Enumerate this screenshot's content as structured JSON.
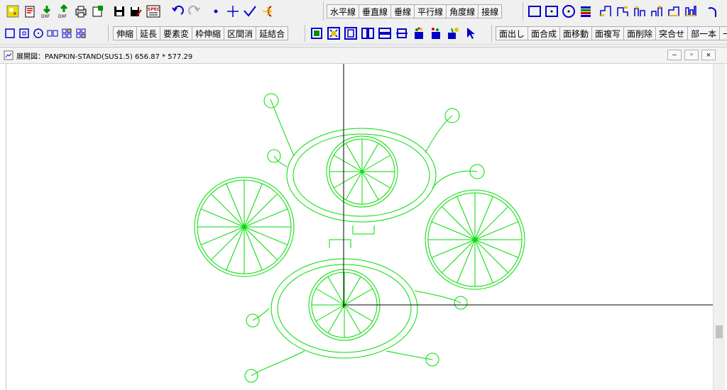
{
  "toolbar": {
    "line_buttons": [
      "水平線",
      "垂直線",
      "垂線",
      "平行線",
      "角度線",
      "接線"
    ],
    "edit_buttons": [
      "伸縮",
      "延長",
      "要素変",
      "枠伸縮",
      "区間消",
      "延結合"
    ],
    "face_buttons": [
      "面出し",
      "面合成",
      "面移動",
      "面複写",
      "面削除",
      "突合せ",
      "部一本",
      "一"
    ],
    "icons": [
      "new-drawing-icon",
      "open-icon",
      "import-dxf-icon",
      "export-dxf-icon",
      "print-icon",
      "print-preview-icon",
      "save-icon",
      "save-as-icon",
      "spec-icon",
      "undo-icon",
      "redo-icon",
      "point-icon",
      "cross-icon",
      "check-icon",
      "arc-icon",
      "rectangle-icon",
      "centered-rectangle-icon",
      "circle-icon",
      "layer-icon",
      "select-arrow-icon"
    ],
    "colors": {
      "icon_blue": "#0000c8",
      "icon_green": "#009000",
      "icon_red": "#d00000",
      "icon_yellow": "#e8c000"
    }
  },
  "window": {
    "title": "展開図：PANPKIN-STAND(SUS1.5) 656.87 * 577.29",
    "minimize_label": "–",
    "restore_label": "▫",
    "close_label": "×"
  },
  "drawing": {
    "stroke_color": "#00dd00",
    "axis_color": "#000000",
    "background": "#ffffff"
  }
}
